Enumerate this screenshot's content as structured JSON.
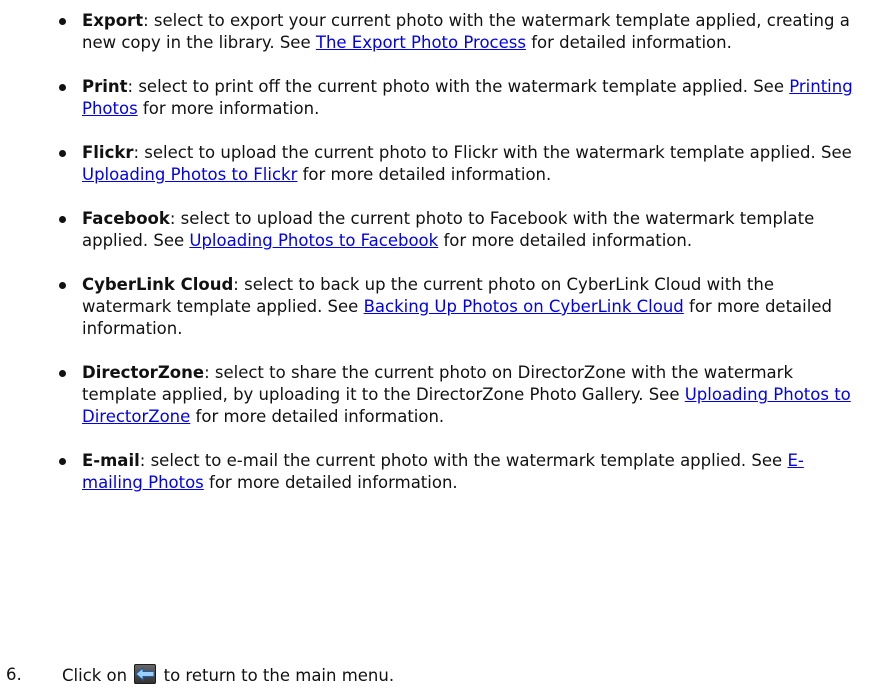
{
  "items": [
    {
      "term": "Export",
      "before": ": select to export your current photo with the watermark template applied, creating a new copy in the library. See ",
      "link": "The Export Photo Process",
      "after": " for detailed information."
    },
    {
      "term": "Print",
      "before": ": select to print off the current photo with the watermark template applied. See ",
      "link": "Printing Photos",
      "after": " for more information."
    },
    {
      "term": "Flickr",
      "before": ": select to upload the current photo to Flickr with the watermark template applied. See ",
      "link": "Uploading Photos to Flickr",
      "after": " for more detailed information."
    },
    {
      "term": "Facebook",
      "before": ": select to upload the current photo to Facebook with the watermark template applied. See ",
      "link": "Uploading Photos to Facebook",
      "after": " for more detailed information."
    },
    {
      "term": "CyberLink Cloud",
      "before": ": select to back up the current photo on CyberLink Cloud with the watermark template applied. See ",
      "link": "Backing Up Photos on CyberLink Cloud",
      "after": " for more detailed information."
    },
    {
      "term": "DirectorZone",
      "before": ": select to share the current photo on DirectorZone with the watermark template applied, by uploading it to the  DirectorZone Photo Gallery. See ",
      "link": "Uploading Photos to DirectorZone",
      "after": " for more detailed information."
    },
    {
      "term": "E-mail",
      "before": ": select to e-mail the current photo with the watermark template applied. See ",
      "link": "E-mailing Photos",
      "after": " for more detailed information."
    }
  ],
  "step": {
    "number": "6.",
    "before": "Click on ",
    "icon": "back-arrow-icon",
    "after": " to return to the main menu."
  },
  "colors": {
    "link": "#0000ee",
    "text": "#111111"
  }
}
